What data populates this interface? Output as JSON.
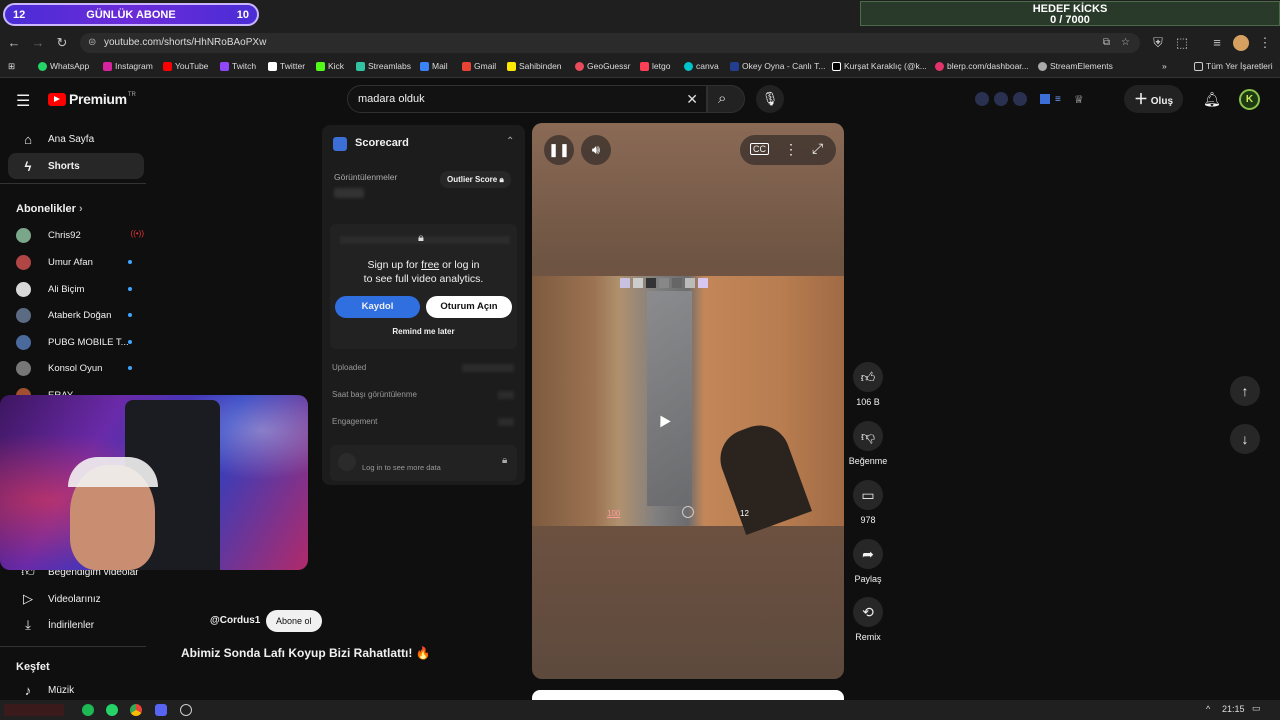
{
  "overlay": {
    "abone_left": "12",
    "abone_label": "GÜNLÜK ABONE",
    "abone_right": "10",
    "hedef_title": "HEDEF KİCKS",
    "hedef_progress": "0 / 7000",
    "hedef_fraction": 0
  },
  "browser": {
    "url": "youtube.com/shorts/HhNRoBAoPXw",
    "bookmarks": [
      "WhatsApp",
      "Instagram",
      "YouTube",
      "Twitch",
      "Twitter",
      "Kick",
      "Streamlabs",
      "Mail",
      "Gmail",
      "Sahibinden",
      "GeoGuessr",
      "letgo",
      "canva",
      "Okey Oyna - Canlı T...",
      "Kurşat Karaklıç (@k...",
      "blerp.com/dashboar...",
      "StreamElements"
    ],
    "all_bookmarks": "Tüm Yer İşaretleri"
  },
  "header": {
    "logo": "Premium",
    "logo_sup": "TR",
    "search_value": "madara olduk",
    "create_label": "Oluş"
  },
  "sidebar": {
    "home": "Ana Sayfa",
    "shorts": "Shorts",
    "subs_title": "Abonelikler",
    "subs": [
      "Chris92",
      "Umur Afan",
      "Ali Biçim",
      "Ataberk Doğan",
      "PUBG MOBILE T...",
      "Konsol Oyun",
      "ERAY"
    ],
    "liked": "Beğendiğim videolar",
    "your_videos": "Videolarınız",
    "downloads": "İndirilenler",
    "explore": "Keşfet",
    "music": "Müzik"
  },
  "scorecard": {
    "title": "Scorecard",
    "views_label": "Görüntülenmeler",
    "outlier": "Outlier Score",
    "signup_line1_a": "Sign up for ",
    "signup_free": "free",
    "signup_line1_b": " or log in",
    "signup_line2": "to see full video analytics.",
    "kaydol": "Kaydol",
    "oturum": "Oturum Açın",
    "remind": "Remind me later",
    "uploaded": "Uploaded",
    "hourly": "Saat başı görüntülenme",
    "engagement": "Engagement",
    "login_more": "Log in to see more data"
  },
  "video": {
    "hud_health": "100",
    "hud_ammo": "12",
    "channel": "@Cordus1",
    "subscribe": "Abone ol",
    "title": "Abimiz Sonda Lafı Koyup Bizi Rahatlattı! 🔥"
  },
  "actions": {
    "likes": "106 B",
    "dislike": "Beğenme",
    "comments": "978",
    "share": "Paylaş",
    "remix": "Remix"
  },
  "taskbar": {
    "time": "21:15"
  }
}
